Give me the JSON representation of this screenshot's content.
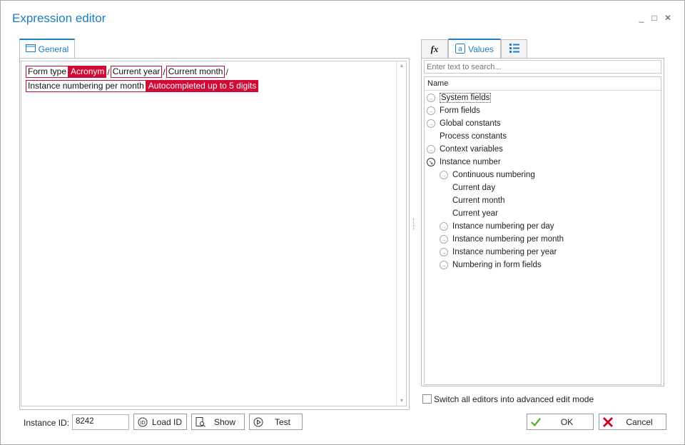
{
  "window": {
    "title": "Expression editor",
    "controls": {
      "minimize": "_",
      "maximize": "□",
      "close": "✕"
    }
  },
  "left_tab": {
    "label": "General"
  },
  "editor": {
    "line1": [
      {
        "text": "Form type",
        "style": "outline"
      },
      {
        "text": "Acronym",
        "style": "red"
      },
      {
        "text": "/",
        "style": "sep"
      },
      {
        "text": "Current year",
        "style": "outline"
      },
      {
        "text": "/",
        "style": "sep"
      },
      {
        "text": "Current month",
        "style": "outline"
      },
      {
        "text": "/",
        "style": "sep"
      }
    ],
    "line2": [
      {
        "text": "Instance numbering per month",
        "style": "outline"
      },
      {
        "text": "Autocompleted up to 5 digits",
        "style": "red"
      }
    ]
  },
  "right_tabs": {
    "fx": {
      "label": "fx"
    },
    "values": {
      "label": "Values"
    },
    "list": {
      "label": ""
    }
  },
  "search": {
    "placeholder": "Enter text to search..."
  },
  "tree": {
    "header": "Name",
    "items": [
      {
        "label": "System fields",
        "level": 0,
        "icon": "circle-arrow",
        "selected": true
      },
      {
        "label": "Form fields",
        "level": 0,
        "icon": "circle-arrow"
      },
      {
        "label": "Global constants",
        "level": 0,
        "icon": "circle-arrow"
      },
      {
        "label": "Process constants",
        "level": 0,
        "icon": "none"
      },
      {
        "label": "Context variables",
        "level": 0,
        "icon": "circle-arrow"
      },
      {
        "label": "Instance number",
        "level": 0,
        "icon": "circle-arrow-open"
      },
      {
        "label": "Continuous numbering",
        "level": 1,
        "icon": "circle-arrow"
      },
      {
        "label": "Current day",
        "level": 1,
        "icon": "none"
      },
      {
        "label": "Current month",
        "level": 1,
        "icon": "none"
      },
      {
        "label": "Current year",
        "level": 1,
        "icon": "none"
      },
      {
        "label": "Instance numbering per day",
        "level": 1,
        "icon": "circle-arrow"
      },
      {
        "label": "Instance numbering per month",
        "level": 1,
        "icon": "circle-arrow"
      },
      {
        "label": "Instance numbering per year",
        "level": 1,
        "icon": "circle-arrow"
      },
      {
        "label": "Numbering in form fields",
        "level": 1,
        "icon": "circle-arrow"
      }
    ]
  },
  "advanced_mode": {
    "label": "Switch all editors into advanced edit mode",
    "checked": false
  },
  "bottom": {
    "instance_id_label": "Instance ID:",
    "instance_id_value": "8242",
    "load_id": "Load ID",
    "show": "Show",
    "test": "Test",
    "ok": "OK",
    "cancel": "Cancel"
  },
  "colors": {
    "accent": "#1a7ec0",
    "token_red": "#d20a36",
    "ok_green": "#4caf24",
    "cancel_red": "#d0021b"
  }
}
